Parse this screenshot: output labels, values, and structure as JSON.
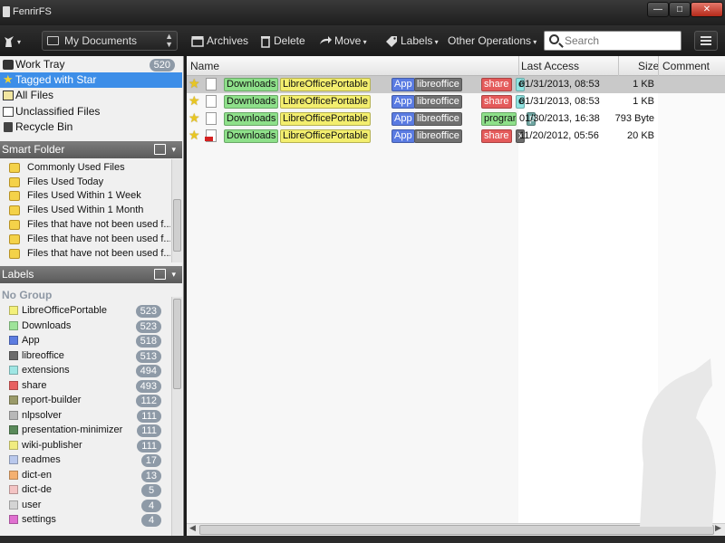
{
  "window": {
    "title": "FenrirFS"
  },
  "toolbar": {
    "location": "My Documents",
    "archives": "Archives",
    "delete": "Delete",
    "move": "Move",
    "labels": "Labels",
    "other_operations": "Other Operations",
    "search_placeholder": "Search"
  },
  "sidebar": {
    "nav": [
      {
        "label": "Work Tray",
        "count": "520",
        "icon": "tray-icon"
      },
      {
        "label": "Tagged with Star",
        "icon": "star-icon",
        "selected": true
      },
      {
        "label": "All Files",
        "icon": "all-files-icon"
      },
      {
        "label": "Unclassified Files",
        "icon": "unclassified-icon"
      },
      {
        "label": "Recycle Bin",
        "icon": "recycle-bin-icon"
      }
    ],
    "smart_folder": {
      "title": "Smart Folder",
      "items": [
        "Commonly Used Files",
        "Files Used Today",
        "Files Used Within 1 Week",
        "Files Used Within 1 Month",
        "Files that have not been used f...",
        "Files that have not been used f...",
        "Files that have not been used f..."
      ]
    },
    "labels": {
      "title": "Labels",
      "group": "No Group",
      "items": [
        {
          "label": "LibreOfficePortable",
          "count": "523",
          "color": "#f3f07a"
        },
        {
          "label": "Downloads",
          "count": "523",
          "color": "#9ee39a"
        },
        {
          "label": "App",
          "count": "518",
          "color": "#5c7ce0"
        },
        {
          "label": "libreoffice",
          "count": "513",
          "color": "#6b6b6b"
        },
        {
          "label": "extensions",
          "count": "494",
          "color": "#9fe6e4"
        },
        {
          "label": "share",
          "count": "493",
          "color": "#e86060"
        },
        {
          "label": "report-builder",
          "count": "112",
          "color": "#9b9b6a"
        },
        {
          "label": "nlpsolver",
          "count": "111",
          "color": "#b8b8b8"
        },
        {
          "label": "presentation-minimizer",
          "count": "111",
          "color": "#5a8a5a"
        },
        {
          "label": "wiki-publisher",
          "count": "111",
          "color": "#f0ec80"
        },
        {
          "label": "readmes",
          "count": "17",
          "color": "#b9c8ec"
        },
        {
          "label": "dict-en",
          "count": "13",
          "color": "#f4b070"
        },
        {
          "label": "dict-de",
          "count": "5",
          "color": "#f4c4c4"
        },
        {
          "label": "user",
          "count": "4",
          "color": "#d4d4d4"
        },
        {
          "label": "settings",
          "count": "4",
          "color": "#e070d0"
        }
      ]
    }
  },
  "table": {
    "columns": [
      "Name",
      "Last Access",
      "Size",
      "Comment"
    ],
    "rows": [
      {
        "tags": [
          "Downloads",
          "LibreOfficePortable",
          "App",
          "libreoffice",
          "share",
          "extensions"
        ],
        "last_access": "01/31/2013, 08:53",
        "size": "1 KB",
        "selected": true
      },
      {
        "tags": [
          "Downloads",
          "LibreOfficePortable",
          "App",
          "libreoffice",
          "share",
          "extensions"
        ],
        "last_access": "01/31/2013, 08:53",
        "size": "1 KB"
      },
      {
        "tags": [
          "Downloads",
          "LibreOfficePortable",
          "App",
          "libreoffice",
          "program",
          "python-"
        ],
        "last_access": "01/30/2013, 16:38",
        "size": "793 Byte"
      },
      {
        "tags": [
          "Downloads",
          "LibreOfficePortable",
          "App",
          "libreoffice",
          "share",
          "xpdfimport"
        ],
        "last_access": "11/20/2012, 05:56",
        "size": "20 KB"
      }
    ]
  },
  "tag_colors": {
    "Downloads": "#8ee08a",
    "LibreOfficePortable": "#f3ee6e",
    "App": "#5a7be2",
    "libreoffice": "#707070",
    "share": "#e45a5a",
    "extensions": "#8fe3e1",
    "program": "#8ee08a",
    "python-": "#6fa6a2",
    "xpdfimport": "#6b6b6b"
  }
}
